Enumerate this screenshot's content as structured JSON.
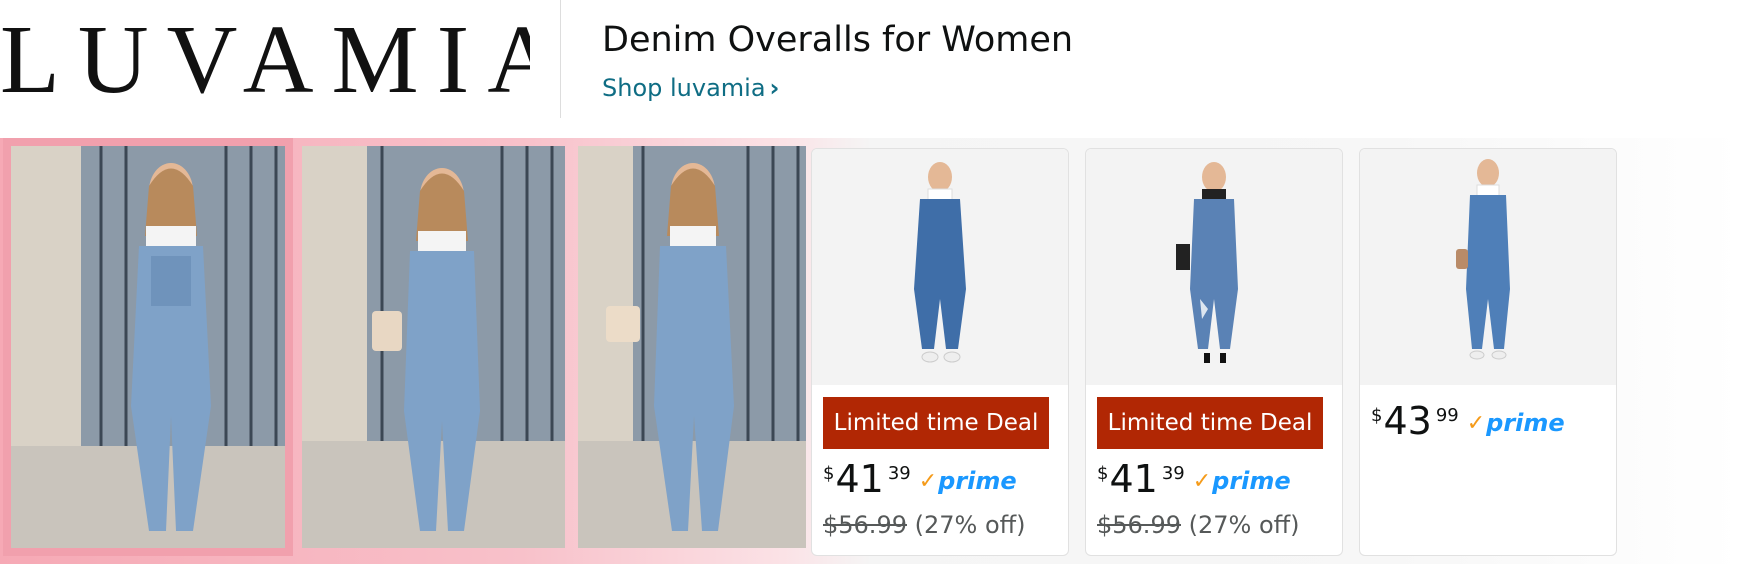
{
  "header": {
    "brand": "LUVAMIA",
    "headline": "Denim Overalls for Women",
    "shop_link": "Shop luvamia",
    "shop_chevron": "›"
  },
  "colors": {
    "deal_red": "#b12704",
    "link_teal": "#0f6d84",
    "prime_blue": "#1a98ff",
    "prime_check": "#f59b1a",
    "pink_accent": "#f1a0ad"
  },
  "lifestyle_photos": [
    {
      "name": "lifestyle-photo-1",
      "selected": true
    },
    {
      "name": "lifestyle-photo-2",
      "selected": false
    },
    {
      "name": "lifestyle-photo-3",
      "selected": false
    }
  ],
  "products": [
    {
      "deal": "Limited time Deal",
      "currency": "$",
      "whole": "41",
      "fraction": "39",
      "prime": "prime",
      "was": "$56.99",
      "off": "(27% off)"
    },
    {
      "deal": "Limited time Deal",
      "currency": "$",
      "whole": "41",
      "fraction": "39",
      "prime": "prime",
      "was": "$56.99",
      "off": "(27% off)"
    },
    {
      "currency": "$",
      "whole": "43",
      "fraction": "99",
      "prime": "prime"
    }
  ]
}
